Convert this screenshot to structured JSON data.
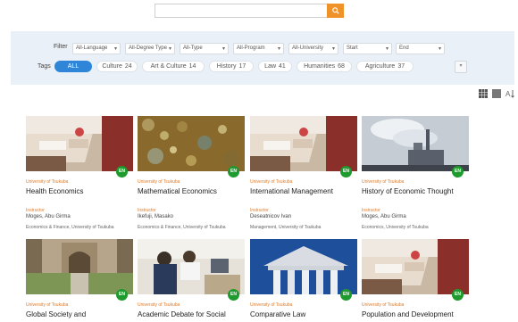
{
  "search": {
    "placeholder": ""
  },
  "filters": {
    "label": "Filter",
    "selects": [
      "All-Language",
      "All-Degree Type",
      "All-Type",
      "All-Program",
      "All-University",
      "Start",
      "End"
    ]
  },
  "tags": {
    "label": "Tags",
    "items": [
      {
        "label": "ALL",
        "count": ""
      },
      {
        "label": "Culture",
        "count": "24"
      },
      {
        "label": "Art & Culture",
        "count": "14"
      },
      {
        "label": "History",
        "count": "17"
      },
      {
        "label": "Law",
        "count": "41"
      },
      {
        "label": "Humanities",
        "count": "68"
      },
      {
        "label": "Agriculture",
        "count": "37"
      }
    ]
  },
  "courses": [
    {
      "univ": "University of Tsukuba",
      "title": "Health Economics",
      "instructor_label": "Instructor",
      "instructor": "Moges, Abu Girma",
      "dept": "Economics & Finance, University of Tsukuba",
      "lang": "EN",
      "image": "classroom"
    },
    {
      "univ": "University of Tsukuba",
      "title": "Mathematical Economics",
      "instructor_label": "Instructor",
      "instructor": "Ikefuji, Masako",
      "dept": "Economics & Finance, University of Tsukuba",
      "lang": "EN",
      "image": "bubbles"
    },
    {
      "univ": "University of Tsukuba",
      "title": "International Management",
      "instructor_label": "Instructor",
      "instructor": "Deseatnicov Ivan",
      "dept": "Management, University of Tsukuba",
      "lang": "EN",
      "image": "classroom"
    },
    {
      "univ": "University of Tsukuba",
      "title": "History of Economic Thought",
      "instructor_label": "Instructor",
      "instructor": "Moges, Abu Girma",
      "dept": "Economics, University of Tsukuba",
      "lang": "EN",
      "image": "factory"
    },
    {
      "univ": "University of Tsukuba",
      "title": "Global Society and",
      "instructor_label": "",
      "instructor": "",
      "dept": "",
      "lang": "EN",
      "image": "courtyard"
    },
    {
      "univ": "University of Tsukuba",
      "title": "Academic Debate for Social",
      "instructor_label": "",
      "instructor": "",
      "dept": "",
      "lang": "EN",
      "image": "students"
    },
    {
      "univ": "University of Tsukuba",
      "title": "Comparative Law",
      "instructor_label": "",
      "instructor": "",
      "dept": "",
      "lang": "EN",
      "image": "columns"
    },
    {
      "univ": "University of Tsukuba",
      "title": "Population and Development",
      "instructor_label": "",
      "instructor": "",
      "dept": "",
      "lang": "EN",
      "image": "classroom"
    }
  ],
  "colors": {
    "accent_orange": "#f0922a",
    "tag_active": "#2f86d8",
    "panel_bg": "#e9f0f7",
    "badge_green": "#1f9a2e"
  },
  "view_icons": [
    "grid-large-icon",
    "grid-small-icon",
    "sort-icon"
  ]
}
